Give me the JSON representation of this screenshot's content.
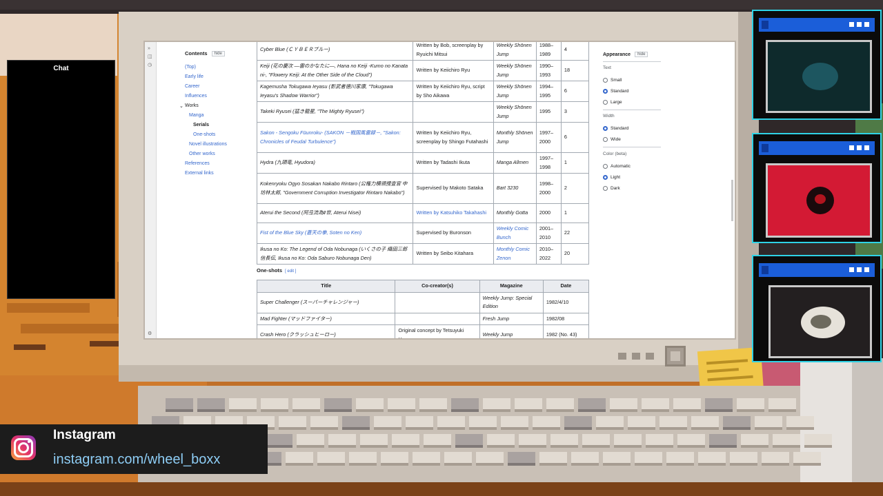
{
  "chat": {
    "title": "Chat"
  },
  "instagram": {
    "name": "Instagram",
    "url": "instagram.com/wheel_boxx"
  },
  "toc": {
    "heading": "Contents",
    "hide_label": "hide",
    "items": [
      "(Top)",
      "Early life",
      "Career",
      "Influences",
      "Works",
      "Manga",
      "Serials",
      "One-shots",
      "Novel illustrations",
      "Other works",
      "References",
      "External links"
    ]
  },
  "serials_table": {
    "rows": [
      {
        "title": "Cyber Blue (ＣＹＢＥＲブルー)",
        "credit": "Written by Bob, screenplay by Ryuichi Mitsui",
        "magazine": "Weekly Shōnen Jump",
        "years": "1988–1989",
        "volumes": "4"
      },
      {
        "title": "Keiji (花の慶次 —雲のかなたに—, Hana no Keiji -Kumo no Kanata ni-, \"Flowery Keiji: At the Other Side of the Cloud\")",
        "credit": "Written by Keiichiro Ryu",
        "magazine": "Weekly Shōnen Jump",
        "years": "1990–1993",
        "volumes": "18"
      },
      {
        "title": "Kagemusha Tokugawa Ieyasu (影武者徳川家康, \"Tokugawa Ieyasu's Shadow Warrior\")",
        "credit": "Written by Keiichiro Ryu, script by Sho Aikawa",
        "magazine": "Weekly Shōnen Jump",
        "years": "1994–1995",
        "volumes": "6"
      },
      {
        "title": "Takeki Ryusei (猛き龍星, \"The Mighty Ryusei\")",
        "credit": "",
        "magazine": "Weekly Shōnen Jump",
        "years": "1995",
        "volumes": "3"
      },
      {
        "title": "Sakon - Sengoku Fūunroku- (SAKON －戦国風雲録－, \"Sakon: Chronicles of Feudal Turbulence\")",
        "credit": "Written by Keiichiro Ryu, screenplay by Shingo Futahashi",
        "magazine": "Monthly Shōnen Jump",
        "years": "1997–2000",
        "volumes": "6"
      },
      {
        "title": "Hydra (九頭竜, Hyudora)",
        "credit": "Written by Tadashi Ikuta",
        "magazine": "Manga Allmen",
        "years": "1997–1998",
        "volumes": "1"
      },
      {
        "title": "Kokenryoku Ogyo Sosakan Nakabo Rintaro (公権力横領捜査官 中坊林太郎, \"Government Corruption Investigator Rintaro Nakabo\")",
        "credit": "Supervised by Makoto Sataka",
        "magazine": "Bart 3230",
        "years": "1998–2000",
        "volumes": "2"
      },
      {
        "title": "Aterui the Second (阿弖流為Ⅱ世, Aterui Nisei)",
        "credit": "Written by Katsuhiko Takahashi",
        "magazine": "Monthly Gotta",
        "years": "2000",
        "volumes": "1"
      },
      {
        "title": "Fist of the Blue Sky (蒼天の拳, Soten no Ken)",
        "credit": "Supervised by Buronson",
        "magazine": "Weekly Comic Bunch",
        "years": "2001–2010",
        "volumes": "22"
      },
      {
        "title": "Ikusa no Ko: The Legend of Oda Nobunaga (いくさの子 織田三郎信長伝, Ikusa no Ko: Oda Saburo Nobunaga Den)",
        "credit": "Written by Seibo Kitahara",
        "magazine": "Monthly Comic Zenon",
        "years": "2010–2022",
        "volumes": "20"
      }
    ]
  },
  "oneshots": {
    "heading": "One-shots",
    "edit_label": "[ edit ]",
    "headers": [
      "Title",
      "Co-creator(s)",
      "Magazine",
      "Date"
    ],
    "rows": [
      {
        "title": "Super Challenger (スーパーチャレンジャー)",
        "cocreator": "",
        "magazine": "Weekly Jump: Special Edition",
        "date": "1982/4/10"
      },
      {
        "title": "Mad Fighter (マッドファイター)",
        "cocreator": "",
        "magazine": "Fresh Jump",
        "date": "1982/08"
      },
      {
        "title": "Crash Hero (クラッシュヒーロー)",
        "cocreator": "Original concept by Tetsuyuki Hanzawa",
        "magazine": "Weekly Jump",
        "date": "1982 (No. 43)"
      }
    ]
  },
  "appearance": {
    "title": "Appearance",
    "hide_label": "hide",
    "text_label": "Text",
    "text_options": [
      "Small",
      "Standard",
      "Large"
    ],
    "width_label": "Width",
    "width_options": [
      "Standard",
      "Wide"
    ],
    "color_label": "Color (beta)",
    "color_options": [
      "Automatic",
      "Light",
      "Dark"
    ]
  },
  "colors": {
    "cyan_frame": "#2fd3e6",
    "window_bar": "#1b5ed9",
    "link": "#3366cc",
    "instagram_url": "#8ecdf5"
  },
  "windows": [
    {
      "icon": "wheel-boxx-logo"
    },
    {
      "icon": "red-skull-logo"
    },
    {
      "icon": "anime-character-avatar"
    }
  ]
}
